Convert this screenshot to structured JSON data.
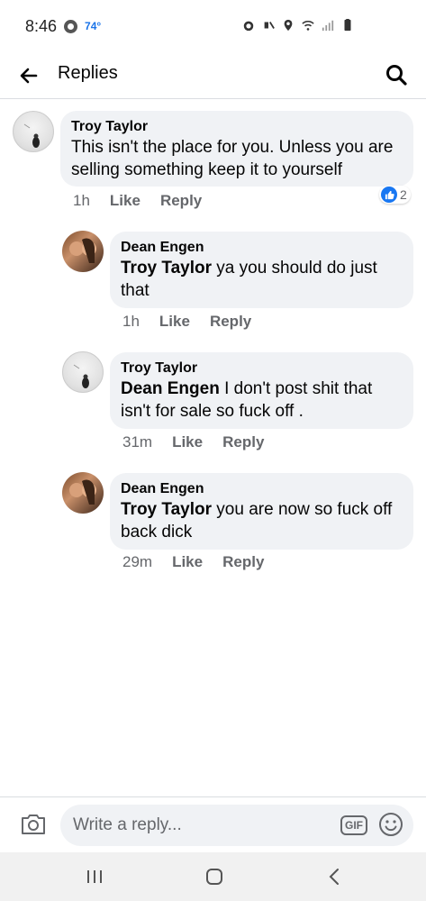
{
  "status_bar": {
    "time": "8:46",
    "temperature": "74°",
    "icons": [
      "chrome-icon",
      "alarm-icon",
      "mute-icon",
      "location-icon",
      "wifi-icon",
      "signal-icon",
      "battery-icon"
    ]
  },
  "header": {
    "title": "Replies",
    "back_icon": "back-arrow-icon",
    "search_icon": "search-icon"
  },
  "comments": [
    {
      "author": "Troy Taylor",
      "mention": "",
      "text": "This isn't the place for you.  Unless you are selling something keep it to yourself",
      "time": "1h",
      "like_label": "Like",
      "reply_label": "Reply",
      "reaction_count": "2"
    },
    {
      "author": "Dean Engen",
      "mention": "Troy Taylor",
      "text": " ya you should do just that",
      "time": "1h",
      "like_label": "Like",
      "reply_label": "Reply"
    },
    {
      "author": "Troy Taylor",
      "mention": "Dean Engen",
      "text": " I don't post shit that isn't for sale so fuck off .",
      "time": "31m",
      "like_label": "Like",
      "reply_label": "Reply"
    },
    {
      "author": "Dean Engen",
      "mention": "Troy Taylor",
      "text": " you are now so fuck off back dick",
      "time": "29m",
      "like_label": "Like",
      "reply_label": "Reply"
    }
  ],
  "composer": {
    "placeholder": "Write a reply...",
    "gif_label": "GIF"
  },
  "colors": {
    "bubble": "#f0f2f5",
    "secondary_text": "#65676b",
    "like_blue": "#1877f2"
  }
}
